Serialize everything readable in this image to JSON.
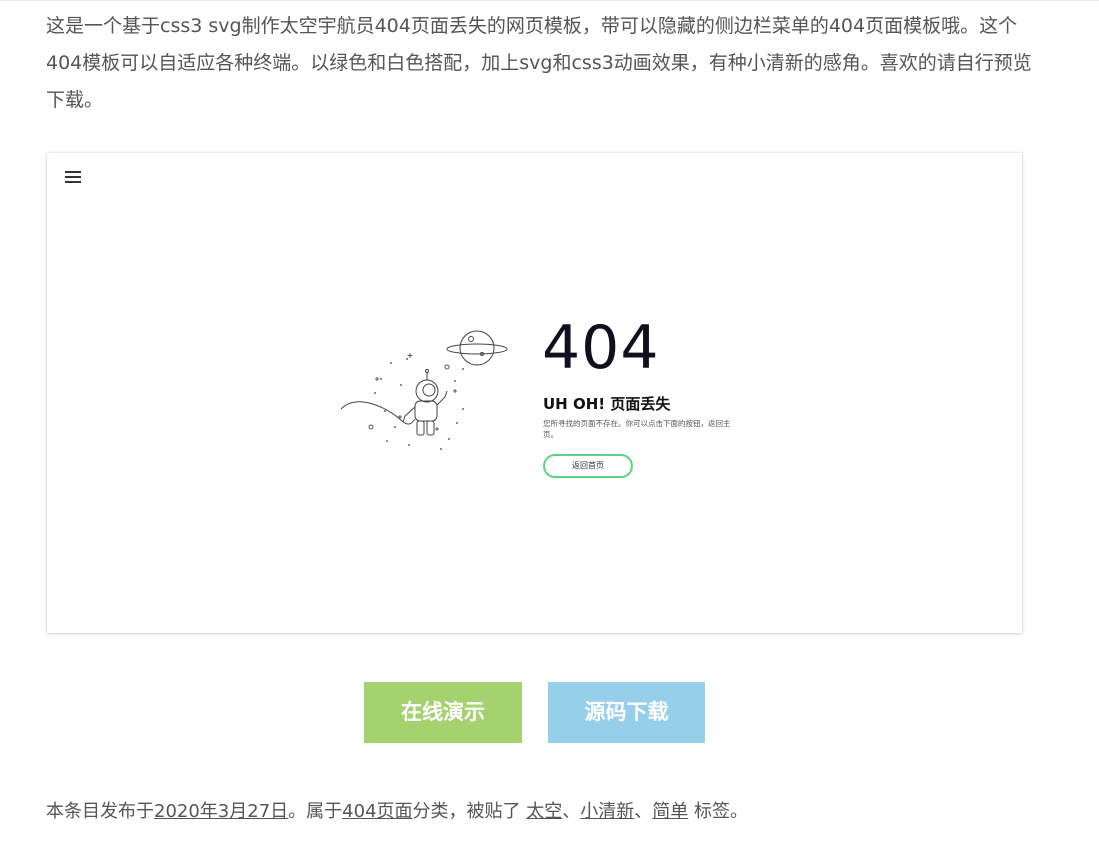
{
  "intro": {
    "text": "这是一个基于css3 svg制作太空宇航员404页面丢失的网页模板，带可以隐藏的侧边栏菜单的404页面模板哦。这个404模板可以自适应各种终端。以绿色和白色搭配，加上svg和css3动画效果，有种小清新的感角。喜欢的请自行预览下载。"
  },
  "preview": {
    "menu_icon": "hamburger-menu-icon",
    "illustration_icon": "astronaut-planet-illustration",
    "code": "404",
    "title": "UH OH! 页面丢失",
    "message": "您所寻找的页面不存在。你可以点击下面的按钮，返回主页。",
    "button_label": "返回首页",
    "accent_color": "#5cd47f"
  },
  "actions": {
    "demo_label": "在线演示",
    "download_label": "源码下载",
    "demo_color": "#a5d16e",
    "download_color": "#95cfe9"
  },
  "footer": {
    "prefix": "本条目发布于",
    "date": "2020年3月27日",
    "after_date": "。属于",
    "category": "404页面",
    "after_category": "分类，被贴了 ",
    "tag1": "太空",
    "sep1": "、",
    "tag2": "小清新",
    "sep2": "、",
    "tag3": "简单",
    "suffix": " 标签。"
  }
}
